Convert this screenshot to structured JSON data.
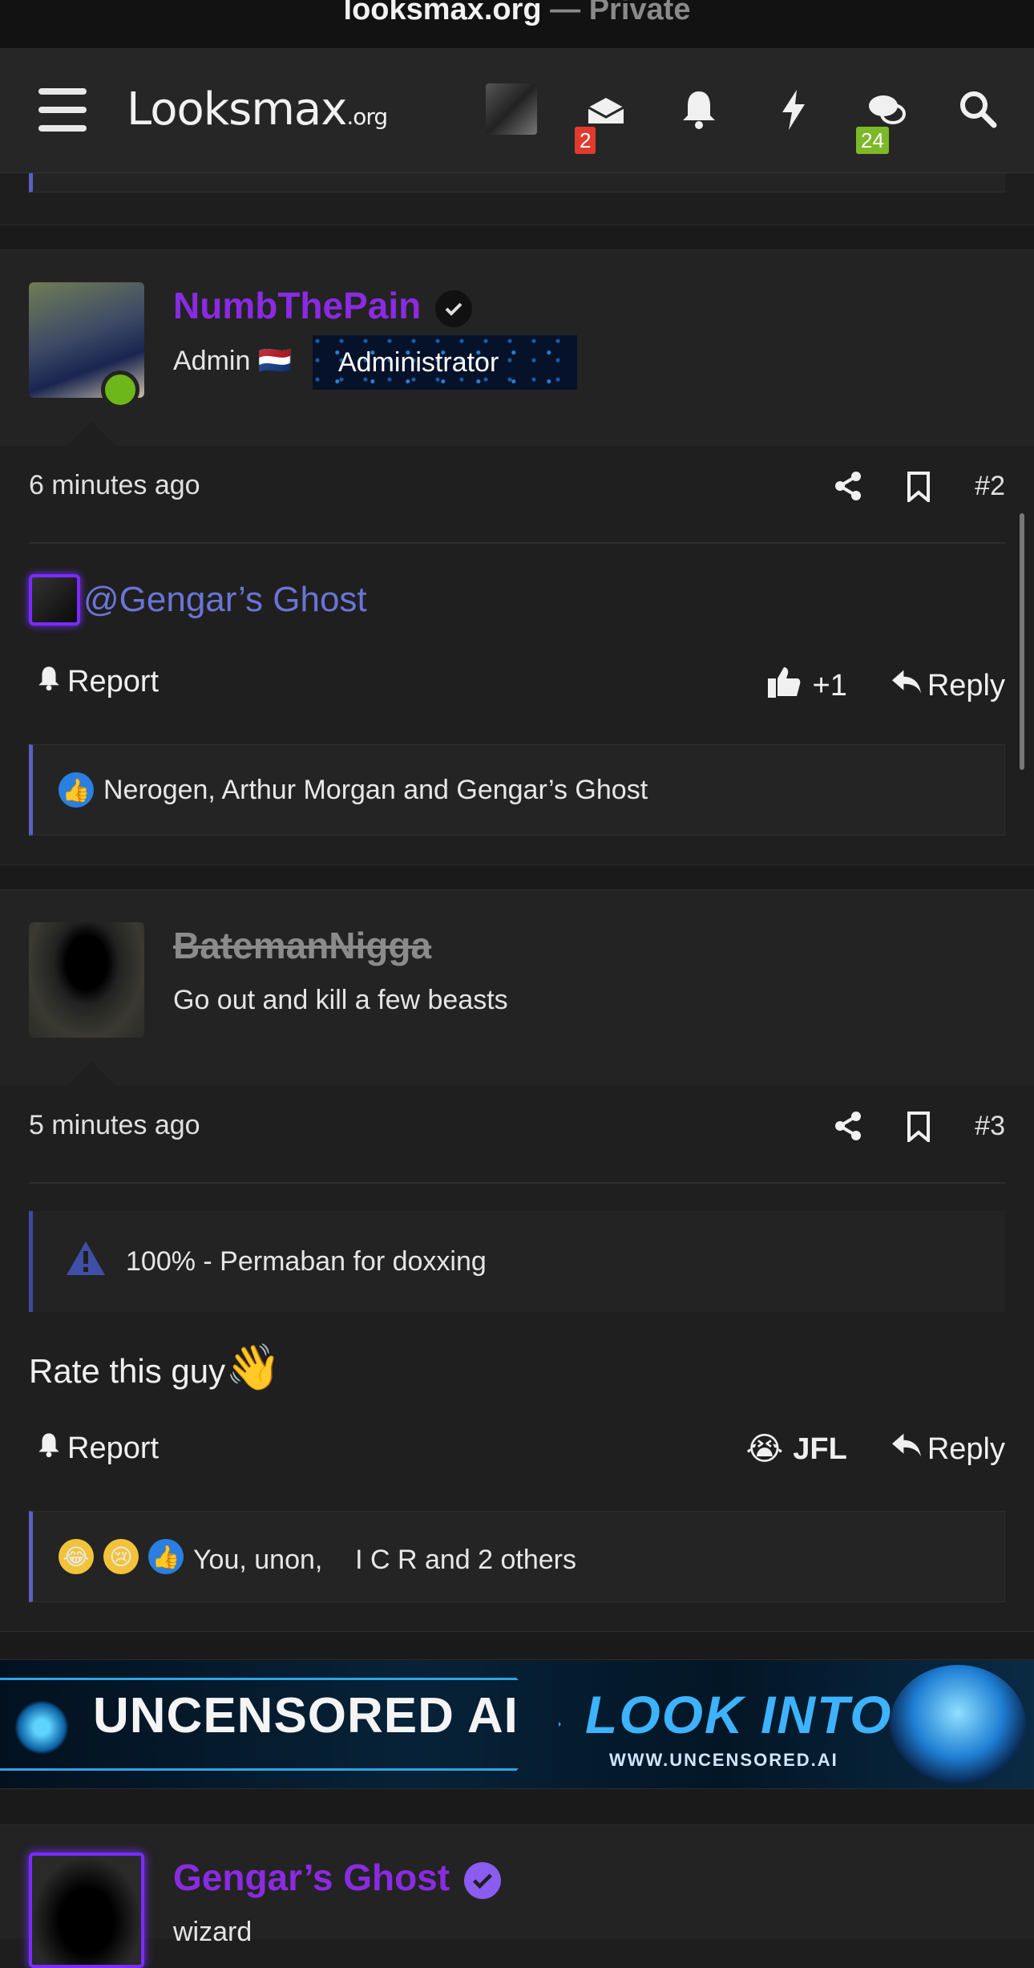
{
  "browser": {
    "site": "looksmax.org",
    "suffix": "— Private"
  },
  "header": {
    "logo_main": "Looksmax",
    "logo_suffix": ".org",
    "inbox_badge": "2",
    "alerts_badge": "24",
    "colors": {
      "inbox_badge": "#e03b2e",
      "alerts_badge": "#7db828"
    }
  },
  "posts": [
    {
      "username": "NumbThePain",
      "username_color": "#8a2be2",
      "role": "Admin",
      "flag": "🇳🇱",
      "banner": "Administrator",
      "time": "6 minutes ago",
      "number": "#2",
      "mention": "@Gengar’s Ghost",
      "report": "Report",
      "reaction_label": "+1",
      "reply": "Reply",
      "reactions_text": "Nerogen, Arthur Morgan and Gengar’s Ghost"
    },
    {
      "username": "BatemanNigga",
      "subtitle": "Go out and kill a few beasts",
      "time": "5 minutes ago",
      "number": "#3",
      "notice": "100% - Permaban for doxxing",
      "body": "Rate this guy",
      "body_emoji": "👋",
      "report": "Report",
      "reaction_label": "JFL",
      "reaction_emoji": "😭",
      "reply": "Reply",
      "reactions_text": "You, unon, ㅤI C R and 2 others"
    },
    {
      "username": "Gengar’s Ghost",
      "subtitle": "wizard"
    }
  ],
  "ad": {
    "left_text": "UNCENSORED AI",
    "right_text": "LOOK INTO IT",
    "url_text": "WWW.UNCENSORED.AI"
  }
}
